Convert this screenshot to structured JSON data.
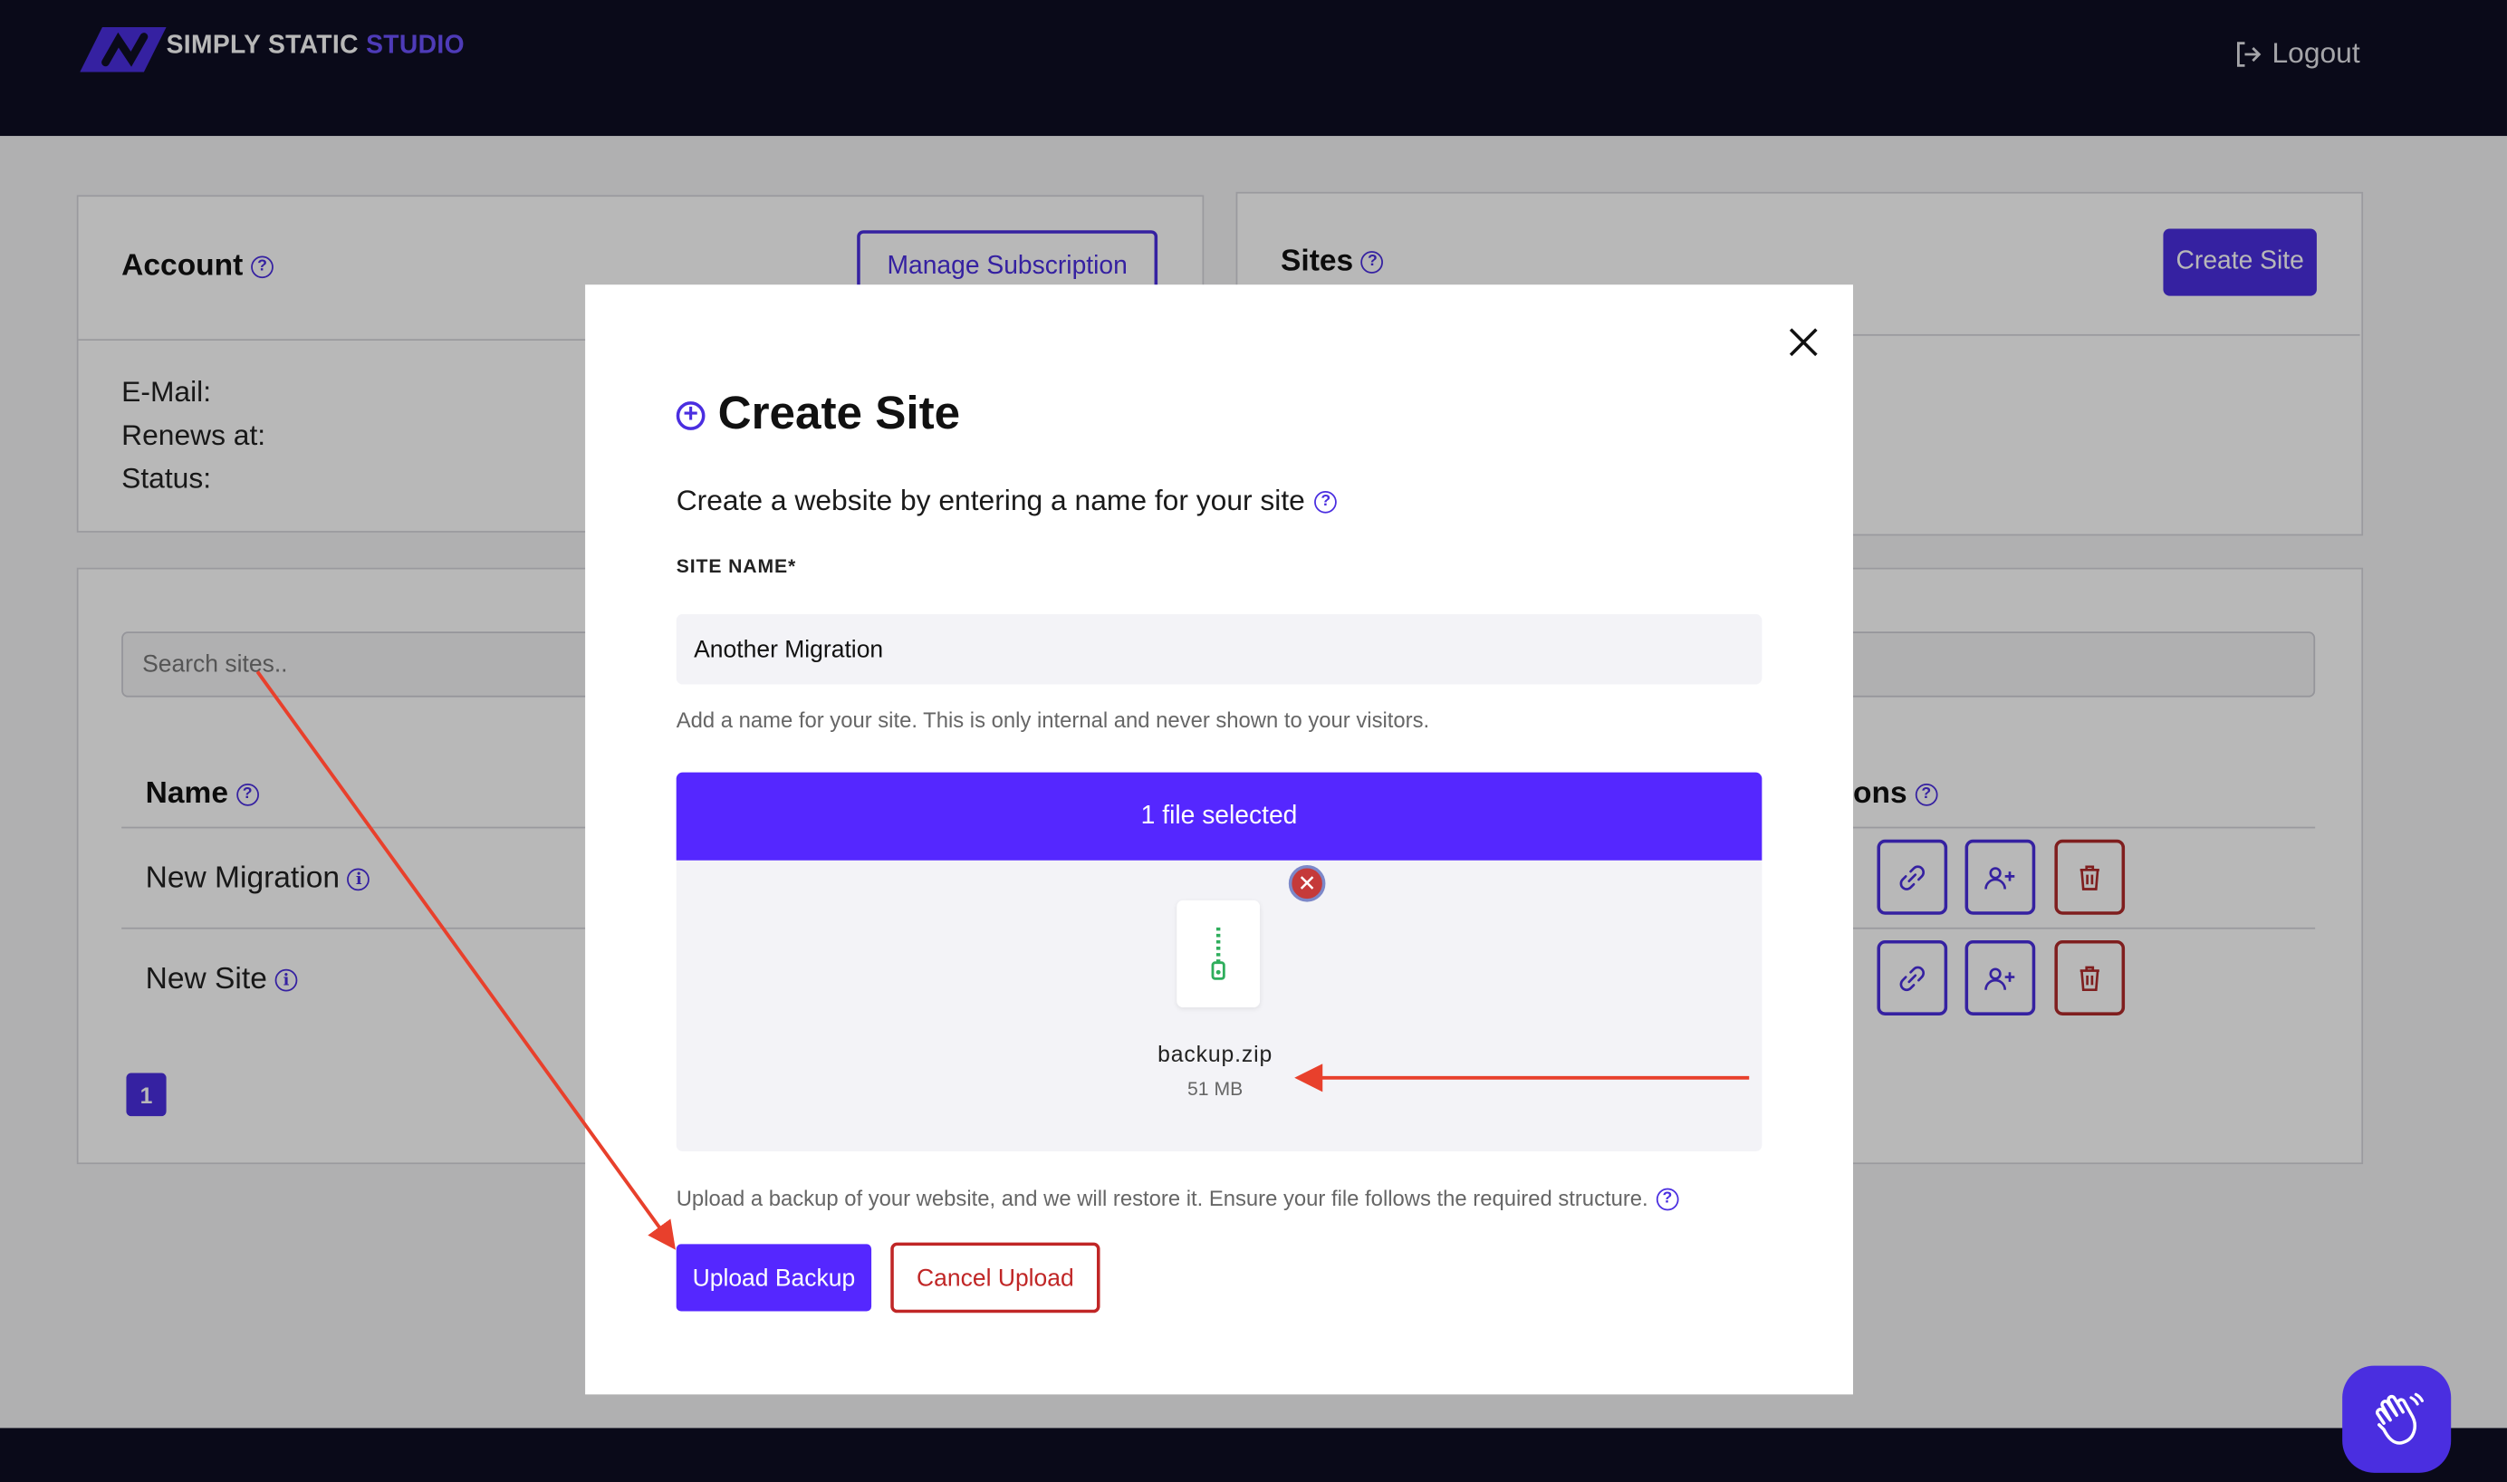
{
  "header": {
    "brand_main": "SIMPLY STATIC",
    "brand_accent": "STUDIO",
    "logout_label": "Logout"
  },
  "account": {
    "title": "Account",
    "manage_label": "Manage Subscription",
    "email_label": "E-Mail:",
    "renews_label": "Renews at:",
    "status_label": "Status:"
  },
  "sites": {
    "title": "Sites",
    "create_label": "Create Site",
    "search_placeholder": "Search sites..",
    "col_name": "Name",
    "col_actions_partial": "ons",
    "rows": [
      {
        "name": "New Migration"
      },
      {
        "name": "New Site"
      }
    ],
    "page": "1"
  },
  "modal": {
    "title": "Create Site",
    "subtitle": "Create a website by entering a name for your site",
    "field_label": "SITE NAME*",
    "field_value": "Another Migration",
    "field_help": "Add a name for your site. This is only internal and never shown to your visitors.",
    "dropzone_status": "1 file selected",
    "remove_symbol": "✕",
    "file_name": "backup.zip",
    "file_size": "51 MB",
    "upload_note": "Upload a backup of your website, and we will restore it. Ensure your file follows the required structure.",
    "upload_label": "Upload Backup",
    "cancel_label": "Cancel Upload"
  },
  "colors": {
    "brand_purple": "#4a2ee0",
    "dropzone_purple": "#5527ff",
    "danger_red": "#c02626",
    "header_navy": "#0f0f23",
    "annotation_arrow": "#e8402c"
  },
  "icons": [
    "logout-icon",
    "help-icon",
    "info-icon",
    "link-icon",
    "add-user-icon",
    "trash-icon",
    "close-icon",
    "plus-circle-icon",
    "zip-file-icon",
    "wave-hand-icon"
  ]
}
